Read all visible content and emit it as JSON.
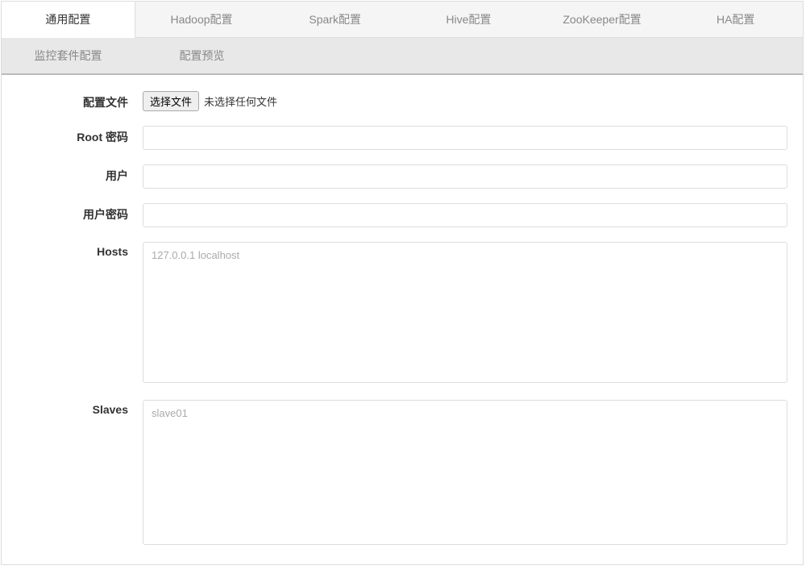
{
  "tabs": {
    "row1": [
      {
        "label": "通用配置",
        "active": true
      },
      {
        "label": "Hadoop配置",
        "active": false
      },
      {
        "label": "Spark配置",
        "active": false
      },
      {
        "label": "Hive配置",
        "active": false
      },
      {
        "label": "ZooKeeper配置",
        "active": false
      },
      {
        "label": "HA配置",
        "active": false
      }
    ],
    "row2": [
      {
        "label": "监控套件配置",
        "active": false
      },
      {
        "label": "配置预览",
        "active": false
      }
    ]
  },
  "form": {
    "config_file": {
      "label": "配置文件",
      "button": "选择文件",
      "status": "未选择任何文件"
    },
    "root_password": {
      "label": "Root 密码",
      "value": ""
    },
    "user": {
      "label": "用户",
      "value": ""
    },
    "user_password": {
      "label": "用户密码",
      "value": ""
    },
    "hosts": {
      "label": "Hosts",
      "placeholder": "127.0.0.1 localhost",
      "value": ""
    },
    "slaves": {
      "label": "Slaves",
      "placeholder": "slave01",
      "value": ""
    }
  }
}
